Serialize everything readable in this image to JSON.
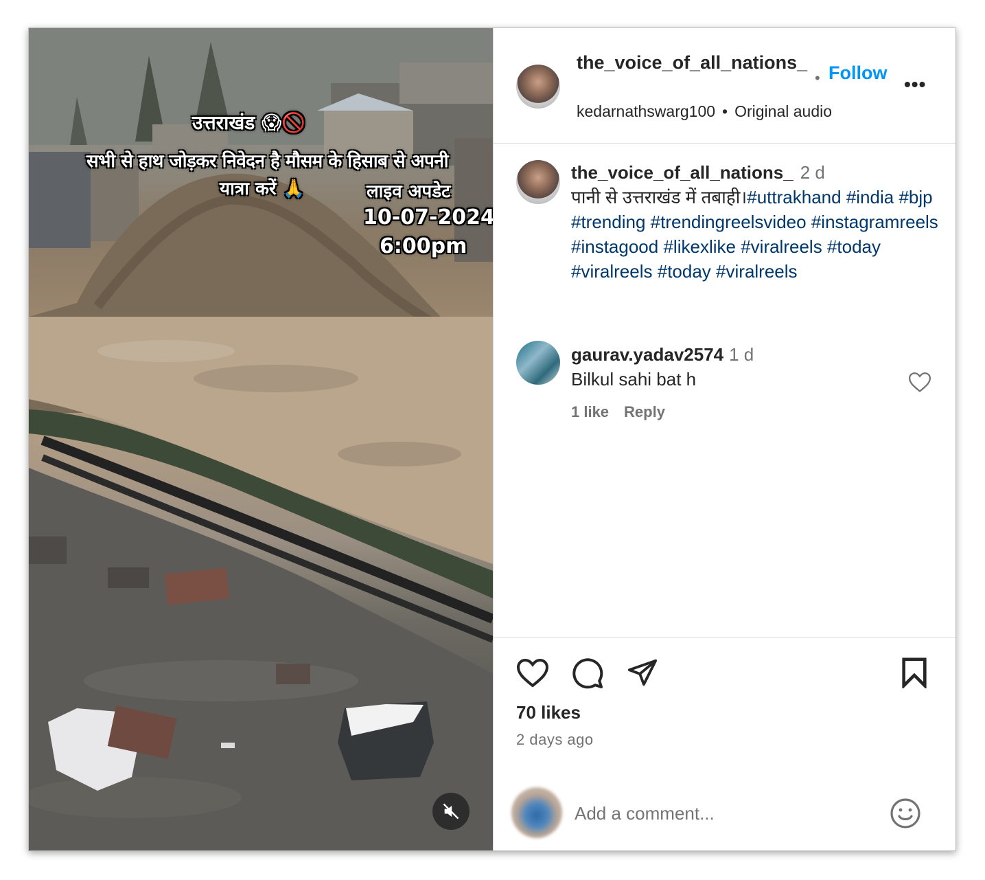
{
  "video": {
    "overlay_title": "उत्तराखंड 😱🚫",
    "overlay_line1": "सभी से हाथ जोड़कर निवेदन है मौसम के हिसाब से अपनी",
    "overlay_line2": "यात्रा करें 🙏",
    "overlay_live": "लाइव अपडेट",
    "overlay_date": "10-07-2024",
    "overlay_time": "6:00pm",
    "mute_icon": "speaker-muted-icon"
  },
  "header": {
    "username": "the_voice_of_all_nations_",
    "dot": "•",
    "follow_label": "Follow",
    "more_label": "•••",
    "audio_user": "kedarnathswarg100",
    "audio_sep": "•",
    "audio_label": "Original audio"
  },
  "caption": {
    "username": "the_voice_of_all_nations_",
    "time": "2 d",
    "text": "पानी से उत्तराखंड में तबाही।",
    "hashtags": [
      "#uttrakhand",
      "#india",
      "#bjp",
      "#trending",
      "#trendingreelsvideo",
      "#instagramreels",
      "#instagood",
      "#likexlike",
      "#viralreels",
      "#today",
      "#viralreels",
      "#today",
      "#viralreels"
    ]
  },
  "comment": {
    "username": "gaurav.yadav2574",
    "time": "1 d",
    "text": "Bilkul sahi bat h",
    "likes_label": "1 like",
    "reply_label": "Reply"
  },
  "footer": {
    "likes": "70 likes",
    "posted_ago": "2 days ago",
    "comment_placeholder": "Add a comment..."
  },
  "colors": {
    "follow": "#0095f6",
    "hashtag": "#00376b",
    "secondary_text": "#737373",
    "border": "#dbdbdb"
  }
}
